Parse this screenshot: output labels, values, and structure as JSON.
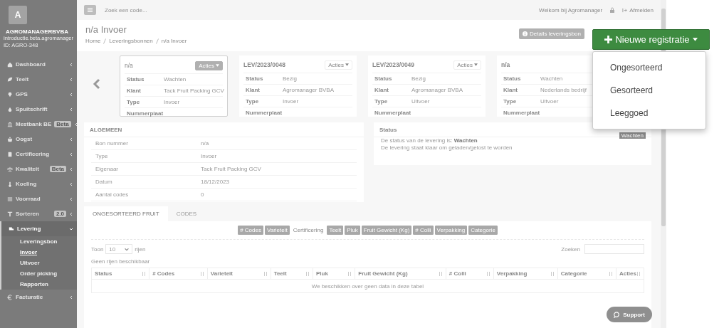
{
  "sidebar": {
    "logo": "A",
    "company": "AGROMANAGERBVBA",
    "subtitle": "introductie.beta.agromanager",
    "account_id": "ID: AGRO-348",
    "items": [
      {
        "label": "Dashboard",
        "selected": false,
        "expanded": false
      },
      {
        "label": "Teelt",
        "selected": false,
        "expanded": false
      },
      {
        "label": "GPS",
        "selected": false,
        "expanded": false
      },
      {
        "label": "Spuitschrift",
        "selected": false,
        "expanded": false
      },
      {
        "label": "Mestbank BE",
        "badge": "Beta",
        "selected": false,
        "expanded": false
      },
      {
        "label": "Oogst",
        "selected": false,
        "expanded": false
      },
      {
        "label": "Certificering",
        "selected": false,
        "expanded": false
      },
      {
        "label": "Kwaliteit",
        "badge": "Beta",
        "selected": false,
        "expanded": false
      },
      {
        "label": "Koeling",
        "selected": false,
        "expanded": false
      },
      {
        "label": "Voorraad",
        "selected": false,
        "expanded": false
      },
      {
        "label": "Sorteren",
        "badge": "2.0",
        "selected": false,
        "expanded": false
      },
      {
        "label": "Levering",
        "selected": true,
        "expanded": true,
        "children": [
          {
            "label": "Leveringsbon",
            "selected": false
          },
          {
            "label": "Invoer",
            "selected": true
          },
          {
            "label": "Uitvoer",
            "selected": false
          },
          {
            "label": "Order picking",
            "selected": false
          },
          {
            "label": "Rapporten",
            "selected": false
          }
        ]
      },
      {
        "label": "Facturatie",
        "selected": false,
        "expanded": false
      }
    ]
  },
  "topbar": {
    "search": {
      "placeholder": "Zoek een code..."
    },
    "welcome": "Welkom bij Agromanager",
    "logout": "Afmelden"
  },
  "header": {
    "title": "n/a Invoer",
    "breadcrumbs": [
      "Home",
      "Leveringsbonnen",
      "n/a Invoer"
    ],
    "details_button": "Details leveringsbon",
    "new_button": "Nieuwe registratie",
    "new_menu": [
      "Ongesorteerd",
      "Gesorteerd",
      "Leeggoed"
    ]
  },
  "cards": [
    {
      "title": "n/a",
      "actions": "Acties",
      "selected": true,
      "rows": [
        {
          "label": "Status",
          "value": "Wachten"
        },
        {
          "label": "Klant",
          "value": "Tack Fruit Packing GCV"
        },
        {
          "label": "Type",
          "value": "Invoer"
        },
        {
          "label": "Nummerplaat"
        }
      ]
    },
    {
      "title": "LEV/2023/0048",
      "actions": "Acties",
      "selected": false,
      "rows": [
        {
          "label": "Status",
          "value": "Bezig"
        },
        {
          "label": "Klant",
          "value": "Agromanager BVBA"
        },
        {
          "label": "Type",
          "value": "Invoer"
        },
        {
          "label": "Nummerplaat"
        }
      ]
    },
    {
      "title": "LEV/2023/0049",
      "actions": "Acties",
      "selected": false,
      "rows": [
        {
          "label": "Status",
          "value": "Bezig"
        },
        {
          "label": "Klant",
          "value": "Agromanager BVBA"
        },
        {
          "label": "Type",
          "value": "Uitvoer"
        },
        {
          "label": "Nummerplaat"
        }
      ]
    },
    {
      "title": "n/a",
      "selected": false,
      "rows": [
        {
          "label": "Status",
          "value": "Wachten"
        },
        {
          "label": "Klant",
          "value": "Nederlands bedrijf"
        },
        {
          "label": "Type",
          "value": "Uitvoer"
        },
        {
          "label": "Nummerplaat"
        }
      ]
    }
  ],
  "general": {
    "title": "ALGEMEEN",
    "rows": [
      {
        "label": "Bon nummer",
        "value": "n/a"
      },
      {
        "label": "Type",
        "value": "Invoer"
      },
      {
        "label": "Eigenaar",
        "value": "Tack Fruit Packing GCV"
      },
      {
        "label": "Datum",
        "value": "18/12/2023"
      },
      {
        "label": "Aantal codes",
        "value": "0"
      }
    ]
  },
  "status": {
    "title": "Status",
    "badge": "Wachten",
    "lines": [
      "De status van de levering is: **Wachten**",
      "De levering staat klaar om geladen/gelost te worden"
    ]
  },
  "tabs": [
    {
      "label": "ONGESORTEERD FRUIT",
      "selected": true
    },
    {
      "label": "CODES",
      "selected": false
    }
  ],
  "column_toggles": [
    {
      "label": "# Codes",
      "on": true
    },
    {
      "label": "Varieteit",
      "on": true
    },
    {
      "label": "Certificering",
      "on": false
    },
    {
      "label": "Teelt",
      "on": true
    },
    {
      "label": "Pluk",
      "on": true
    },
    {
      "label": "Fruit Gewicht (Kg)",
      "on": true
    },
    {
      "label": "# Colli",
      "on": true
    },
    {
      "label": "Verpakking",
      "on": true
    },
    {
      "label": "Categorie",
      "on": true
    }
  ],
  "table": {
    "show_label": "Toon",
    "page_size": "10",
    "rows_label": "rijen",
    "search_label": "Zoeken",
    "info": "Geen rijen beschikbaar",
    "columns": [
      "Status",
      "# Codes",
      "Varieteit",
      "Teelt",
      "Pluk",
      "Fruit Gewicht (Kg)",
      "# Colli",
      "Verpakking",
      "Categorie",
      "Acties"
    ],
    "empty": "We beschikken over geen data in deze tabel"
  },
  "support": "Support"
}
